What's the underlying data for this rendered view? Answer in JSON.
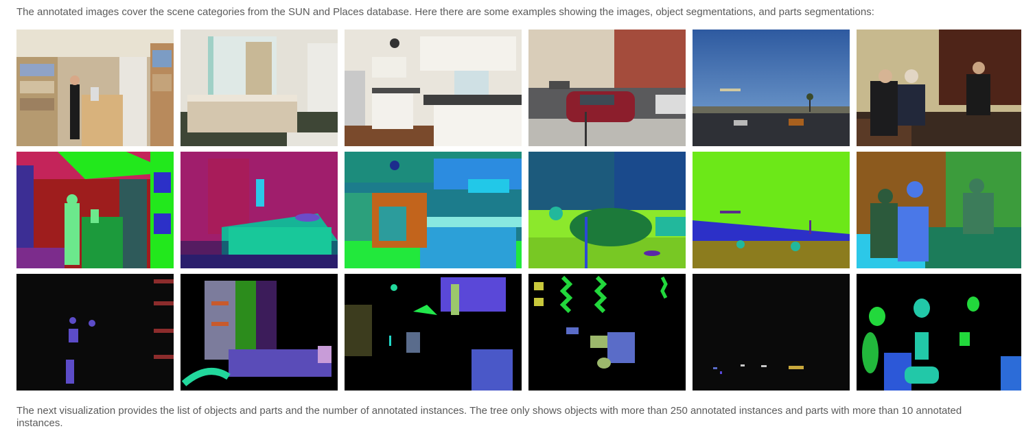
{
  "intro_text": "The annotated images cover the scene categories from the SUN and Places database. Here there are some examples showing the images, object segmentations, and parts segmentations:",
  "outro_text": "The next visualization provides the list of objects and parts and the number of annotated instances. The tree only shows objects with more than 250 annotated instances and parts with more than 10 annotated instances.",
  "rows": [
    {
      "kind": "photo",
      "tiles": [
        "bookstore-photo",
        "bedroom-photo",
        "kitchen-photo",
        "street-photo",
        "highway-photo",
        "bar-photo"
      ]
    },
    {
      "kind": "object-segmentation",
      "tiles": [
        "bookstore-object-seg",
        "bedroom-object-seg",
        "kitchen-object-seg",
        "street-object-seg",
        "highway-object-seg",
        "bar-object-seg"
      ]
    },
    {
      "kind": "parts-segmentation",
      "tiles": [
        "bookstore-parts-seg",
        "bedroom-parts-seg",
        "kitchen-parts-seg",
        "street-parts-seg",
        "highway-parts-seg",
        "bar-parts-seg"
      ]
    }
  ]
}
